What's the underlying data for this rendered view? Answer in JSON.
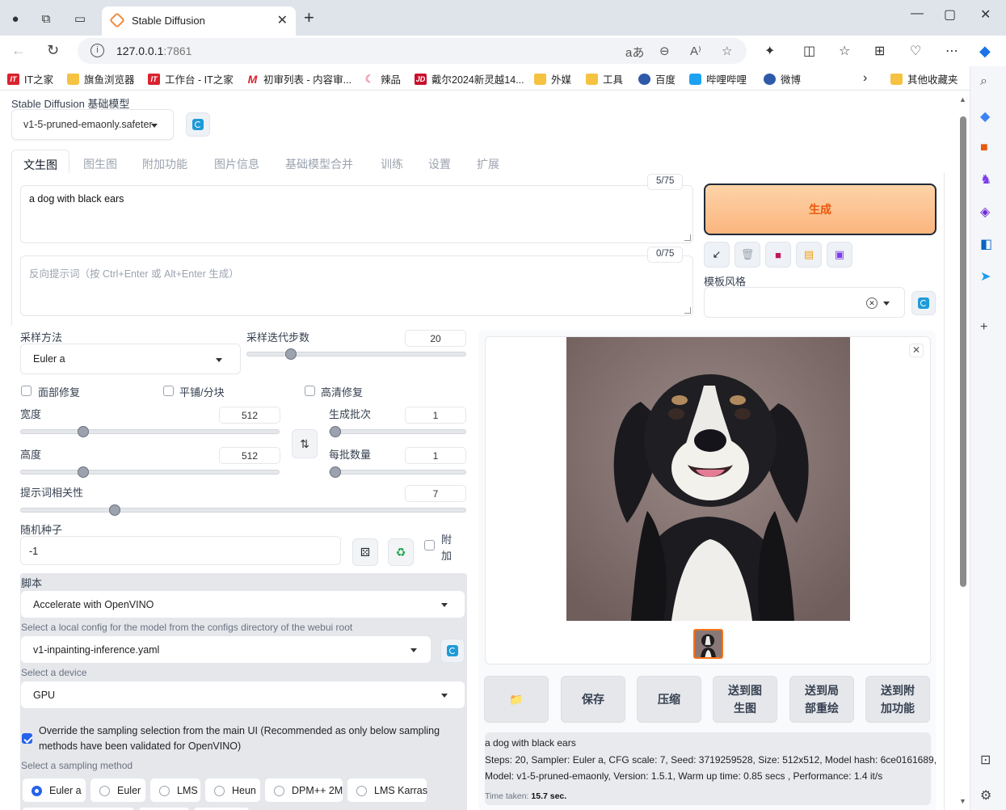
{
  "browser": {
    "tab_title": "Stable Diffusion",
    "url_host": "127.0.0.1",
    "url_port": ":7861",
    "bookmarks": [
      "IT之家",
      "旗鱼浏览器",
      "工作台 - IT之家",
      "初审列表 - 内容审...",
      "辣品",
      "戴尔2024新灵越14...",
      "外媒",
      "工具",
      "百度",
      "哔哩哔哩",
      "微博"
    ],
    "other_bookmarks": "其他收藏夹"
  },
  "checkpoint": {
    "label": "Stable Diffusion 基础模型",
    "value": "v1-5-pruned-emaonly.safeter"
  },
  "tabs": [
    "文生图",
    "图生图",
    "附加功能",
    "图片信息",
    "基础模型合并",
    "训练",
    "设置",
    "扩展"
  ],
  "prompt": {
    "text": "a dog with black ears",
    "token_count": "5/75",
    "negative_placeholder": "反向提示词（按 Ctrl+Enter 或 Alt+Enter 生成）",
    "negative_token_count": "0/75"
  },
  "generate": {
    "label": "生成",
    "style_label": "模板风格"
  },
  "settings": {
    "sampler_label": "采样方法",
    "sampler_value": "Euler a",
    "steps_label": "采样迭代步数",
    "steps_value": "20",
    "steps_fraction": 0.2,
    "face_restore": "面部修复",
    "tiling": "平铺/分块",
    "hires_fix": "高清修复",
    "width_label": "宽度",
    "width_value": "512",
    "width_fraction": 0.24,
    "height_label": "高度",
    "height_value": "512",
    "height_fraction": 0.24,
    "batch_count_label": "生成批次",
    "batch_count_value": "1",
    "batch_size_label": "每批数量",
    "batch_size_value": "1",
    "cfg_label": "提示词相关性",
    "cfg_value": "7",
    "cfg_fraction": 0.21,
    "seed_label": "随机种子",
    "seed_value": "-1",
    "extra_label_1": "附",
    "extra_label_2": "加"
  },
  "script": {
    "label": "脚本",
    "value": "Accelerate with OpenVINO",
    "config_label": "Select a local config for the model from the configs directory of the webui root",
    "config_value": "v1-inpainting-inference.yaml",
    "device_label": "Select a device",
    "device_value": "GPU",
    "override_text": "Override the sampling selection from the main UI (Recommended as only below sampling methods have been validated for OpenVINO)",
    "sampling_label": "Select a sampling method",
    "sampling_methods": [
      "Euler a",
      "Euler",
      "LMS",
      "Heun",
      "DPM++ 2M",
      "LMS Karras"
    ]
  },
  "output": {
    "buttons": {
      "save": "保存",
      "zip": "压缩",
      "to_img2img_1": "送到图",
      "to_img2img_2": "生图",
      "to_inpaint_1": "送到局",
      "to_inpaint_2": "部重绘",
      "to_extras_1": "送到附",
      "to_extras_2": "加功能"
    },
    "info_prompt": "a dog with black ears",
    "info_params_1": "Steps: 20, Sampler: Euler a, CFG scale: 7, Seed: 3719259528, Size: 512x512, Model hash: 6ce0161689,",
    "info_params_2": "Model: v1-5-pruned-emaonly, Version: 1.5.1, Warm up time: 0.85 secs , Performance: 1.4 it/s",
    "time_label": "Time taken: ",
    "time_value": "15.7 sec."
  }
}
